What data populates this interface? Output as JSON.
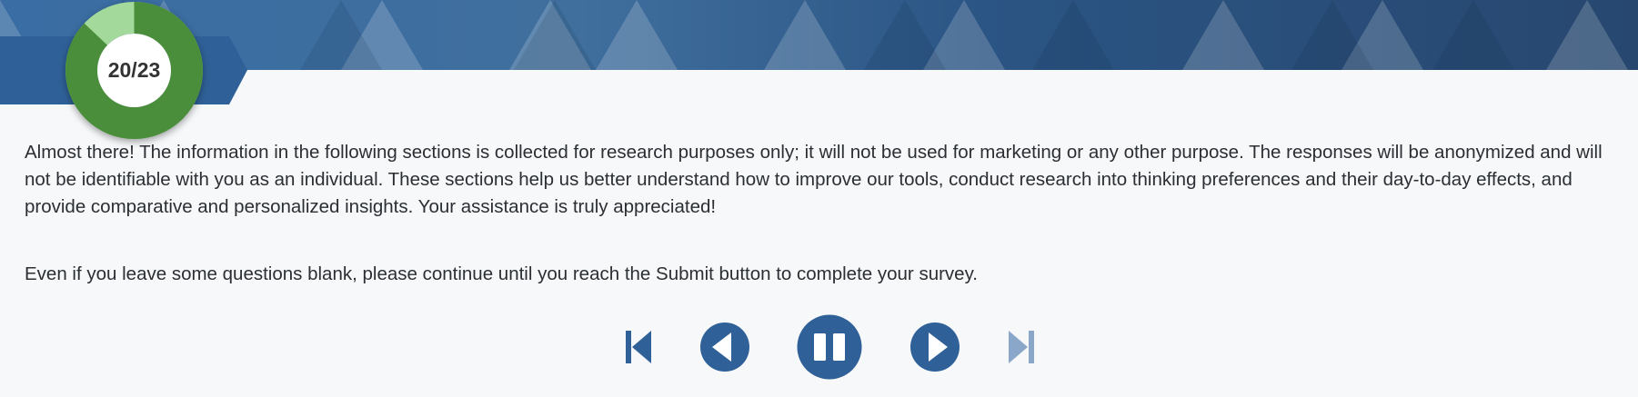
{
  "progress": {
    "label": "20/23",
    "current": 20,
    "total": 23,
    "fill_color": "#4a8d3a",
    "remaining_color": "#a3d99a"
  },
  "intro_text": "Almost there! The information in the following sections is collected for research purposes only; it will not be used for marketing or any other purpose. The responses will be anonymized and will not be identifiable with you as an individual. These sections help us better understand how to improve our tools, conduct research into thinking preferences and their day-to-day effects, and provide comparative and personalized insights. Your assistance is truly appreciated!",
  "note_text": "Even if you leave some questions blank, please continue until you reach the Submit button to complete your survey.",
  "nav": {
    "buttons": [
      {
        "name": "first-page-button",
        "icon": "skip-to-start-icon",
        "enabled": true
      },
      {
        "name": "previous-button",
        "icon": "previous-icon",
        "enabled": true
      },
      {
        "name": "pause-button",
        "icon": "pause-icon",
        "enabled": true
      },
      {
        "name": "next-button",
        "icon": "next-icon",
        "enabled": true
      },
      {
        "name": "last-page-button",
        "icon": "skip-to-end-icon",
        "enabled": false
      }
    ]
  },
  "colors": {
    "accent": "#2f6198",
    "disabled": "#8aa6c8",
    "banner": "#2e5a8a"
  }
}
